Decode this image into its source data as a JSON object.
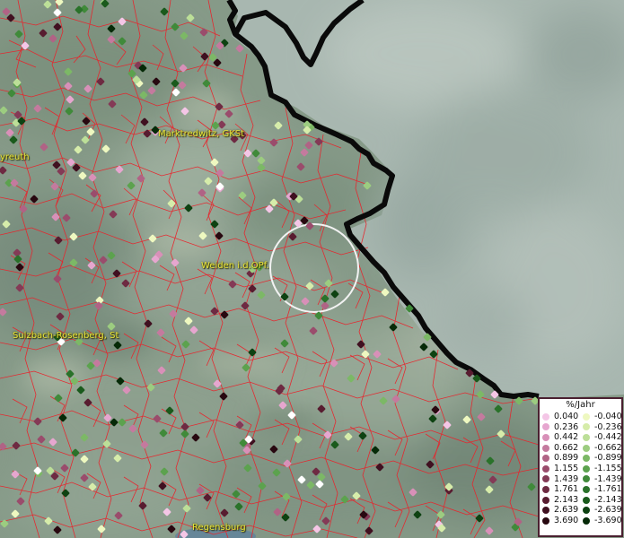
{
  "map": {
    "place_labels": [
      {
        "name": "Marktredwitz, GKSt"
      },
      {
        "name": "yreuth"
      },
      {
        "name": "Weiden i.d.OPf."
      },
      {
        "name": "Sulzbach-Rosenberg, St"
      },
      {
        "name": "Regensburg"
      }
    ]
  },
  "legend": {
    "title": "%/Jahr",
    "positive": [
      {
        "label": "0.040",
        "color": "#f4c6e6"
      },
      {
        "label": "0.236",
        "color": "#e6a6cf"
      },
      {
        "label": "0.442",
        "color": "#d890b8"
      },
      {
        "label": "0.662",
        "color": "#c47a9e"
      },
      {
        "label": "0.899",
        "color": "#b06385"
      },
      {
        "label": "1.155",
        "color": "#9a4c6c"
      },
      {
        "label": "1.439",
        "color": "#843a56"
      },
      {
        "label": "1.761",
        "color": "#6e2a42"
      },
      {
        "label": "2.143",
        "color": "#581c30"
      },
      {
        "label": "2.639",
        "color": "#401020"
      },
      {
        "label": "3.690",
        "color": "#280810"
      }
    ],
    "negative": [
      {
        "label": "-0.040",
        "color": "#eef8c0"
      },
      {
        "label": "-0.236",
        "color": "#d6ecaa"
      },
      {
        "label": "-0.442",
        "color": "#bcdf98"
      },
      {
        "label": "-0.662",
        "color": "#9ccc80"
      },
      {
        "label": "-0.899",
        "color": "#7cb866"
      },
      {
        "label": "-1.155",
        "color": "#5ca24e"
      },
      {
        "label": "-1.439",
        "color": "#408a3a"
      },
      {
        "label": "-1.761",
        "color": "#2a722a"
      },
      {
        "label": "-2.143",
        "color": "#1a5a1c"
      },
      {
        "label": "-2.639",
        "color": "#0e4212"
      },
      {
        "label": "-3.690",
        "color": "#062a08"
      }
    ]
  },
  "colors": {
    "border_lines": "#e8242c",
    "national_border": "#0a0a0a",
    "focus_circle": "#f2f2f2",
    "land_base": "#8a9c8a",
    "neighbor_area": "#a9b9b2"
  }
}
